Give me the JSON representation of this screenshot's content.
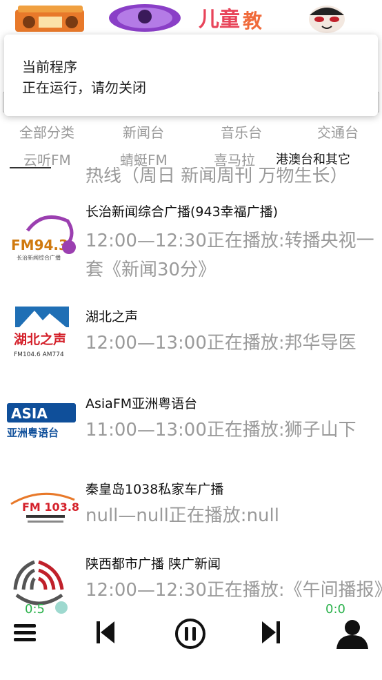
{
  "top_logos": [
    {
      "icon": "radio-logo-icon"
    },
    {
      "icon": "disc-logo-icon"
    },
    {
      "icon": "kids-logo-icon",
      "text": "儿童"
    },
    {
      "icon": "opera-mask-logo-icon"
    }
  ],
  "toast": {
    "title": "当前程序",
    "message": "正在运行，请勿关闭"
  },
  "categories": {
    "row1": [
      "全部分类",
      "新闻台",
      "音乐台",
      "交通台"
    ],
    "row2": [
      "云听FM",
      "蜻蜓FM",
      "喜马拉",
      "港澳台和其它"
    ],
    "active": "港澳台和其它"
  },
  "stations": [
    {
      "name": "",
      "program": "热线（周日 新闻周刊 万物生长）",
      "logo": "partial-logo"
    },
    {
      "name": "长治新闻综合广播(943幸福广播)",
      "program": "12:00—12:30正在播放:转播央视一套《新闻30分》",
      "logo": "fm943-logo-icon",
      "logo_text": "FM94.3",
      "logo_sub": "长治新闻综合广播"
    },
    {
      "name": "湖北之声",
      "program": "12:00—13:00正在播放:邦华导医",
      "logo": "hubei-voice-logo-icon",
      "logo_text": "湖北之声",
      "logo_sub": "FM104.6 AM774"
    },
    {
      "name": "AsiaFM亚洲粤语台",
      "program": "11:00—13:00正在播放:狮子山下",
      "logo": "asia-fm-logo-icon",
      "logo_text": "ASIA",
      "logo_sub": "亚洲粤语台"
    },
    {
      "name": "秦皇岛1038私家车广播",
      "program": "null—null正在播放:null",
      "logo": "fm1038-logo-icon",
      "logo_text": "FM 103.8"
    },
    {
      "name": "陕西都市广播 陕广新闻",
      "program": "12:00—12:30正在播放:《午间播报》",
      "logo": "shaanxi-logo-icon"
    }
  ],
  "player": {
    "elapsed": "0:5",
    "remaining": "0:0",
    "accent": "#2bb24c"
  }
}
